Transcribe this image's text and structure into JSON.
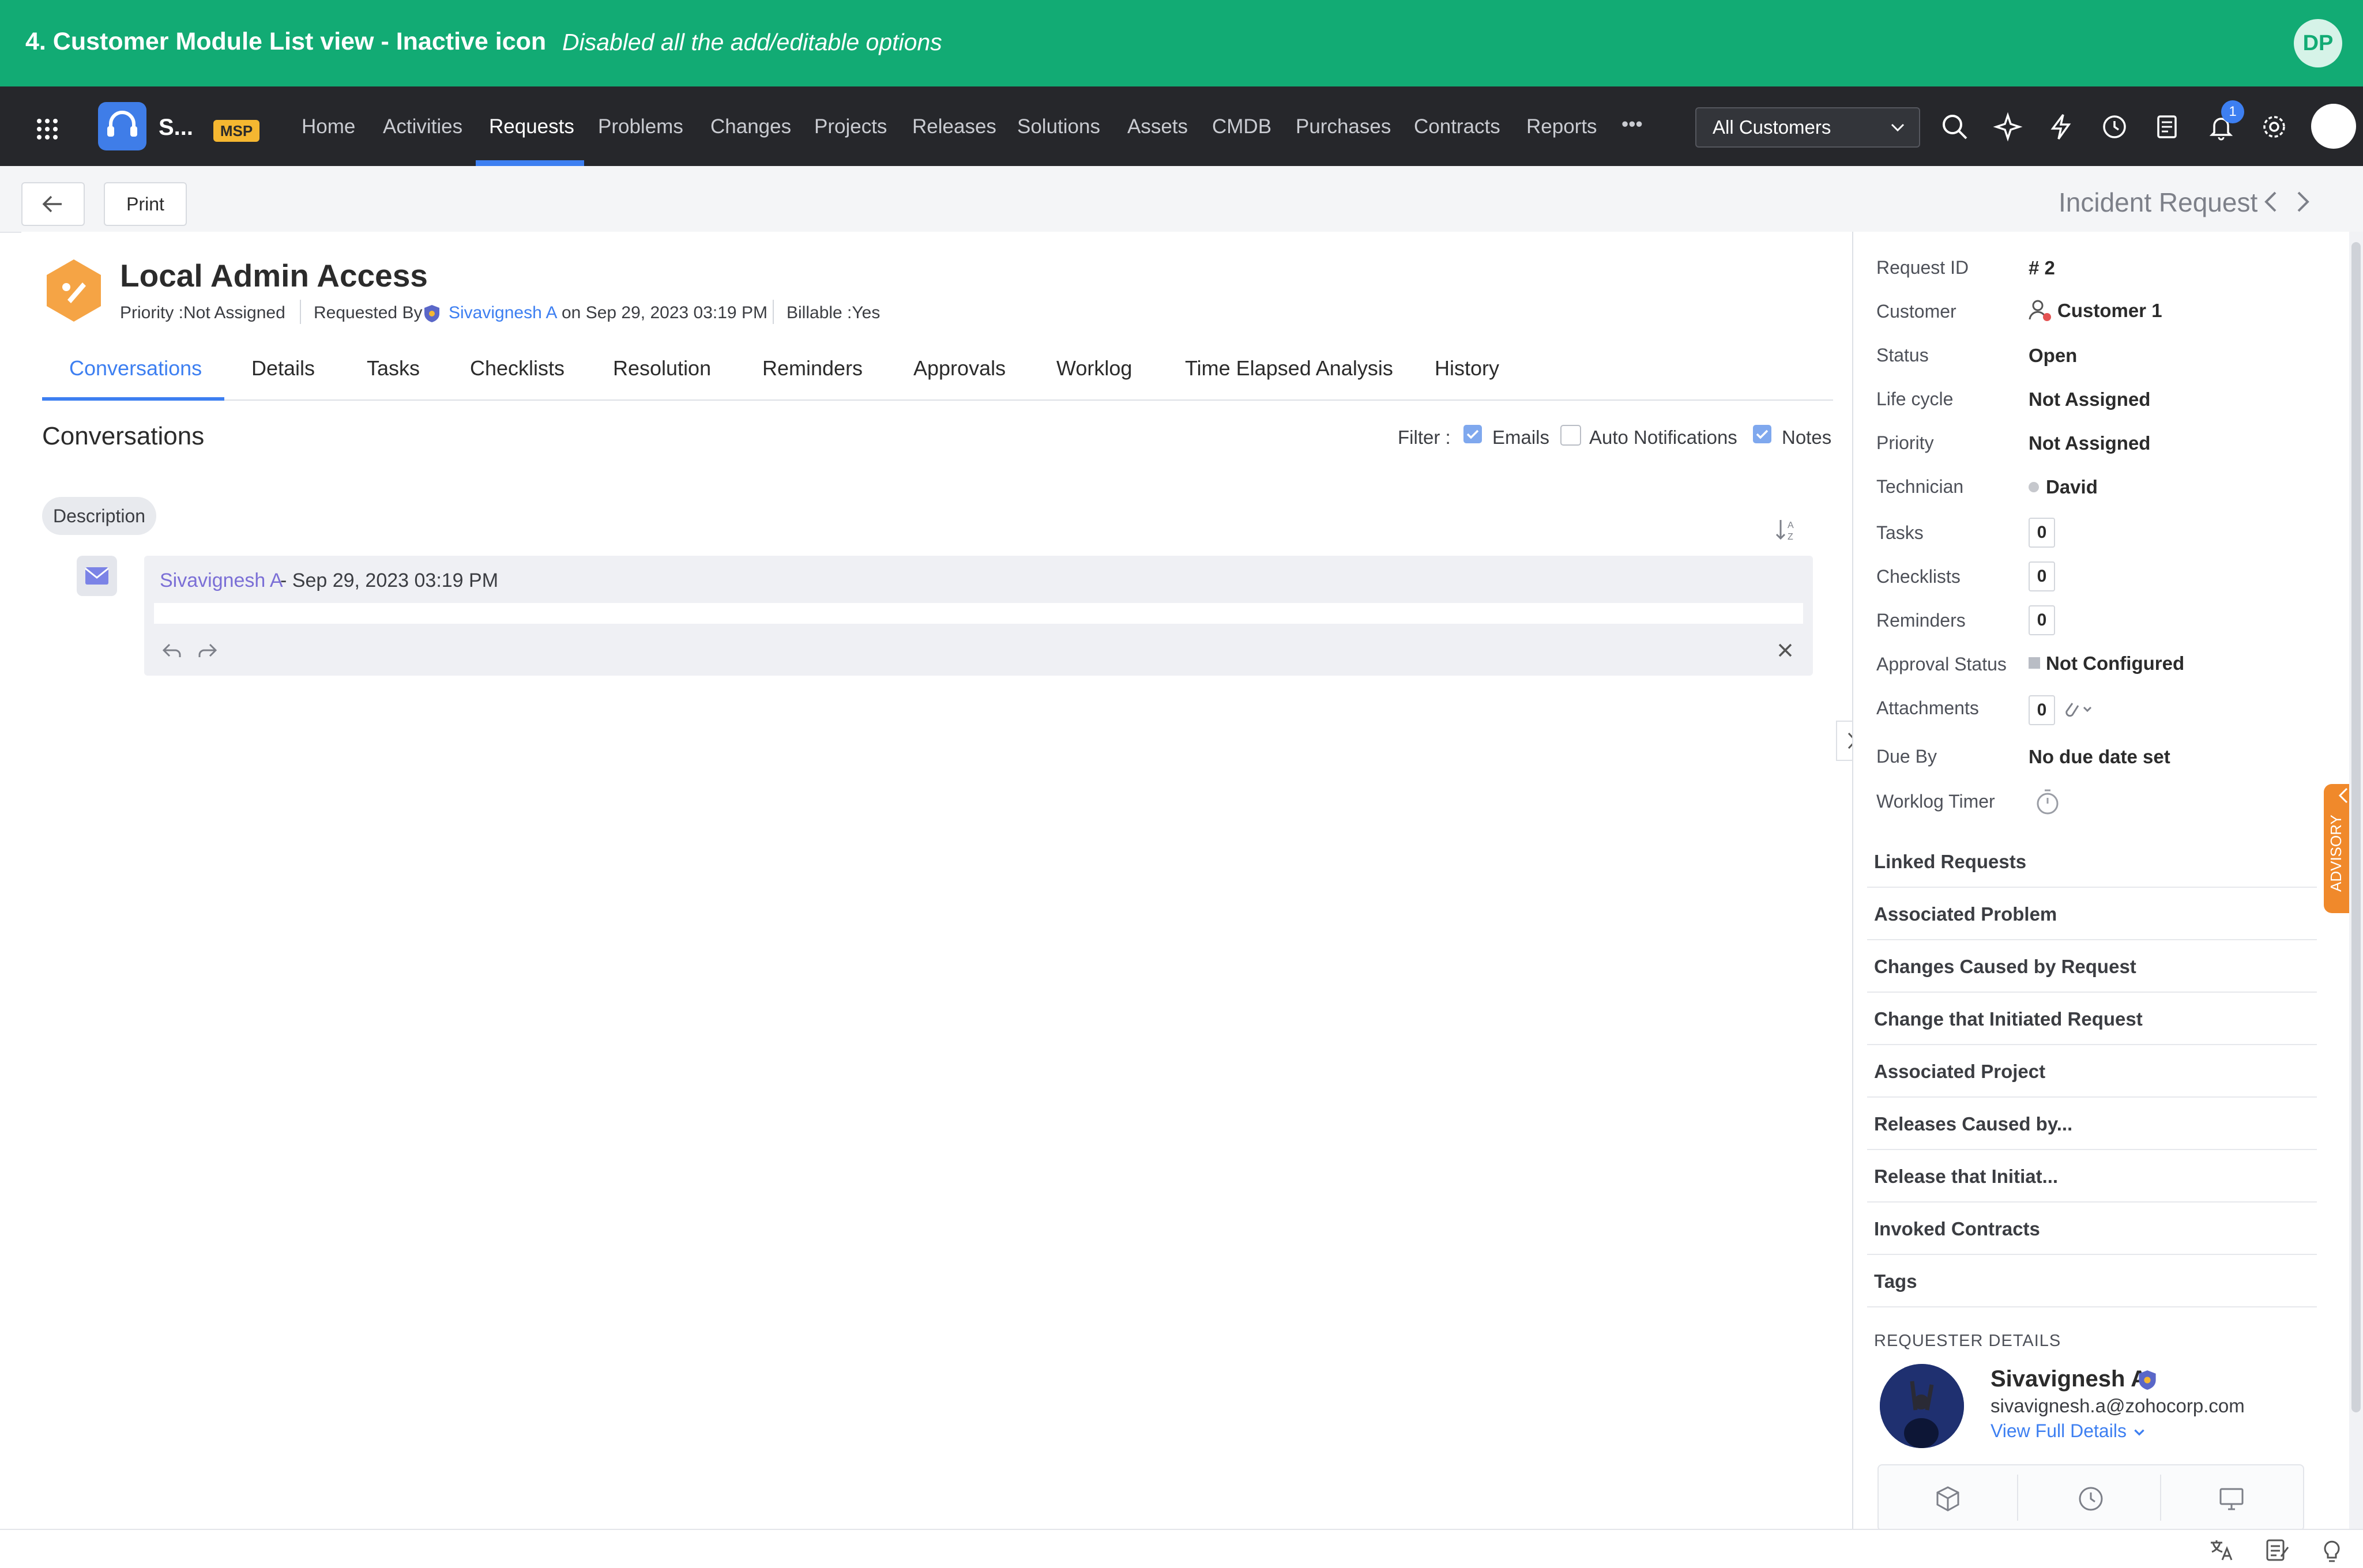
{
  "banner": {
    "title": "4. Customer Module List view - Inactive icon",
    "note": "Disabled all the add/editable options",
    "user_initials": "DP"
  },
  "nav": {
    "app_name": "S...",
    "badge": "MSP",
    "items": [
      {
        "label": "Home"
      },
      {
        "label": "Activities"
      },
      {
        "label": "Requests"
      },
      {
        "label": "Problems"
      },
      {
        "label": "Changes"
      },
      {
        "label": "Projects"
      },
      {
        "label": "Releases"
      },
      {
        "label": "Solutions"
      },
      {
        "label": "Assets"
      },
      {
        "label": "CMDB"
      },
      {
        "label": "Purchases"
      },
      {
        "label": "Contracts"
      },
      {
        "label": "Reports"
      }
    ],
    "active": "Requests",
    "more": "•••",
    "customer_select": "All Customers",
    "notification_count": "1",
    "icons": [
      "search-icon",
      "sparkle-icon",
      "lightning-icon",
      "history-icon",
      "notes-icon",
      "bell-icon",
      "gear-icon"
    ]
  },
  "toolbar": {
    "print_label": "Print",
    "request_type": "Incident Request"
  },
  "ticket": {
    "title": "Local Admin Access",
    "priority": "Priority :Not Assigned",
    "requested_by_label": "Requested By",
    "requester": "Sivavignesh A",
    "requested_on": "on Sep 29, 2023 03:19 PM",
    "billable": "Billable :Yes"
  },
  "tabs": [
    {
      "label": "Conversations"
    },
    {
      "label": "Details"
    },
    {
      "label": "Tasks"
    },
    {
      "label": "Checklists"
    },
    {
      "label": "Resolution"
    },
    {
      "label": "Reminders"
    },
    {
      "label": "Approvals"
    },
    {
      "label": "Worklog"
    },
    {
      "label": "Time Elapsed Analysis"
    },
    {
      "label": "History"
    }
  ],
  "conversations": {
    "heading": "Conversations",
    "filter_label": "Filter :",
    "filters": [
      {
        "label": "Emails",
        "checked": true
      },
      {
        "label": "Auto Notifications",
        "checked": false
      },
      {
        "label": "Notes",
        "checked": true
      }
    ],
    "description_chip": "Description",
    "entry": {
      "author": "Sivavignesh A",
      "date": "- Sep 29, 2023 03:19 PM"
    }
  },
  "properties": [
    {
      "label": "Request ID",
      "value": "# 2"
    },
    {
      "label": "Customer",
      "value": "Customer 1"
    },
    {
      "label": "Status",
      "value": "Open"
    },
    {
      "label": "Life cycle",
      "value": "Not Assigned"
    },
    {
      "label": "Priority",
      "value": "Not Assigned"
    },
    {
      "label": "Technician",
      "value": "David"
    },
    {
      "label": "Tasks",
      "value": "0"
    },
    {
      "label": "Checklists",
      "value": "0"
    },
    {
      "label": "Reminders",
      "value": "0"
    },
    {
      "label": "Approval Status",
      "value": "Not Configured"
    },
    {
      "label": "Attachments",
      "value": "0"
    },
    {
      "label": "Due By",
      "value": "No due date set"
    },
    {
      "label": "Worklog Timer",
      "value": ""
    }
  ],
  "link_sections": [
    "Linked Requests",
    "Associated Problem",
    "Changes Caused by Request",
    "Change that Initiated Request",
    "Associated Project",
    "Releases Caused by...",
    "Release that Initiat...",
    "Invoked Contracts",
    "Tags"
  ],
  "requester_details": {
    "heading": "REQUESTER DETAILS",
    "name": "Sivavignesh A",
    "email": "sivavignesh.a@zohocorp.com",
    "view_link": "View Full Details"
  },
  "advisory": "ADVISORY",
  "colors": {
    "banner": "#12ab74",
    "nav_bg": "#26272b",
    "accent": "#3d7ff1",
    "advisory": "#f0892b"
  }
}
